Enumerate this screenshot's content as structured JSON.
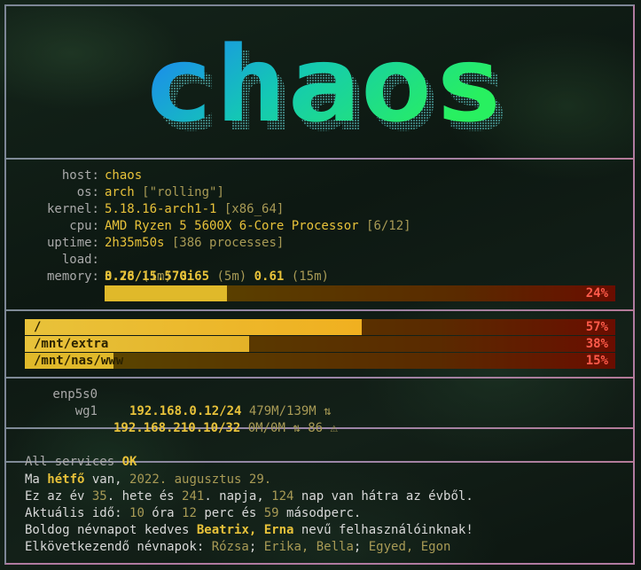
{
  "logo": {
    "text": "chaos",
    "gradient": [
      "#1e78ff",
      "#14c8b4",
      "#28f060"
    ]
  },
  "info": [
    {
      "key": "host:",
      "value": "chaos",
      "dim": ""
    },
    {
      "key": "os:",
      "value": "arch",
      "dim": "[\"rolling\"]"
    },
    {
      "key": "kernel:",
      "value": "5.18.16-arch1-1",
      "dim": "[x86_64]"
    },
    {
      "key": "cpu:",
      "value": "AMD Ryzen 5 5600X 6-Core Processor",
      "dim": "[6/12]"
    },
    {
      "key": "uptime:",
      "value": "2h35m50s",
      "dim": "[386 processes]"
    }
  ],
  "load": {
    "key": "load:",
    "l1": "0.28",
    "l1_unit": "(1m)",
    "l5": "0.65",
    "l5_unit": "(5m)",
    "l15": "0.61",
    "l15_unit": "(15m)"
  },
  "memory": {
    "key": "memory:",
    "value": "3.76/15.57Gi",
    "percent_text": "24%",
    "fraction": 0.24
  },
  "disks": [
    {
      "mount": "/",
      "percent_text": "57%",
      "fraction": 0.57
    },
    {
      "mount": "/mnt/extra",
      "percent_text": "38%",
      "fraction": 0.38
    },
    {
      "mount": "/mnt/nas/www",
      "percent_text": "15%",
      "fraction": 0.15
    }
  ],
  "network": [
    {
      "iface": "enp5s0",
      "ip": "192.168.0.12/24",
      "traffic": "479M/139M",
      "arrows": "⇅",
      "extra": ""
    },
    {
      "iface": "wg1",
      "ip": "192.168.210.10/32",
      "traffic": "0M/0M",
      "arrows": "⇅",
      "extra": "86 ⚠"
    }
  ],
  "services": {
    "prefix": "All services",
    "status": "OK"
  },
  "greeting": {
    "l1": [
      "Ma ",
      "hétfő",
      " van, ",
      "2022. augusztus 29."
    ],
    "l2": [
      "Ez az év ",
      "35",
      ". hete és ",
      "241",
      ". napja, ",
      "124",
      " nap van hátra az évből."
    ],
    "l3": [
      "Aktuális idő: ",
      "10",
      " óra ",
      "12",
      " perc és ",
      "59",
      " másodperc."
    ],
    "l4": [
      "Boldog névnapot kedves ",
      "Beatrix, Erna",
      " nevű felhasználóinknak!"
    ],
    "l5": [
      "Elkövetkezendő névnapok: ",
      "Rózsa",
      "; ",
      "Erika, Bella",
      "; ",
      "Egyed, Egon"
    ]
  },
  "colors": {
    "accent": "#e8c23a",
    "bar_fill": "#e0b92a",
    "bar_track": "#5a4a00",
    "warn": "#ff5a4a"
  }
}
